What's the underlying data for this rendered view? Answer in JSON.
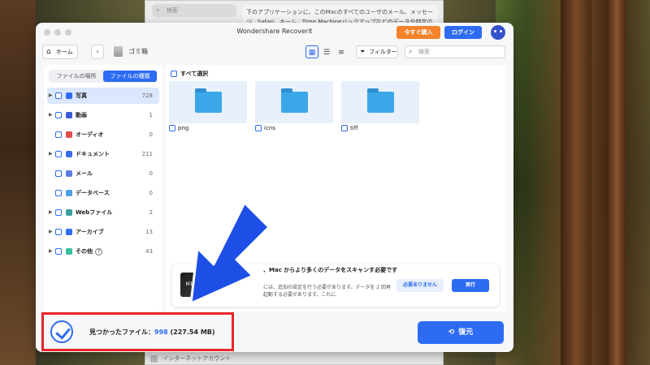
{
  "background_window": {
    "search_placeholder": "検索",
    "description": "下のアプリケーションに、このMacのすべてのユーザのメール、メッセージ、Safari、ホーム、Time Machineバックアップなどのデータや特定の管理設定へ",
    "bottom_item": "インターネットアカウント"
  },
  "app": {
    "title": "Wondershare Recoverit",
    "buy_label": "今すぐ購入",
    "login_label": "ログイン"
  },
  "toolbar": {
    "home_label": "ホーム",
    "crumb": "ゴミ箱",
    "filter_label": "フィルター",
    "search_placeholder": "検索"
  },
  "sidebar": {
    "tabs": [
      "ファイルの場所",
      "ファイルの種類"
    ],
    "active_tab": 1,
    "categories": [
      {
        "label": "写真",
        "count": "728",
        "icon_color": "#2d6cf2",
        "expand": true,
        "active": true
      },
      {
        "label": "動画",
        "count": "1",
        "icon_color": "#3b5bd6",
        "expand": true
      },
      {
        "label": "オーディオ",
        "count": "0",
        "icon_color": "#e34a4a",
        "expand": false
      },
      {
        "label": "ドキュメント",
        "count": "211",
        "icon_color": "#3a6ee8",
        "expand": true
      },
      {
        "label": "メール",
        "count": "0",
        "icon_color": "#5b7ee0",
        "expand": false
      },
      {
        "label": "データベース",
        "count": "0",
        "icon_color": "#4aa0e0",
        "expand": false
      },
      {
        "label": "Webファイル",
        "count": "2",
        "icon_color": "#3aa0a0",
        "expand": true
      },
      {
        "label": "アーカイブ",
        "count": "13",
        "icon_color": "#2d6cf2",
        "expand": true
      },
      {
        "label": "その他",
        "count": "43",
        "icon_color": "#35c0a0",
        "expand": true
      }
    ]
  },
  "main": {
    "select_all": "すべて選択",
    "folders": [
      "png",
      "icns",
      "tiff"
    ]
  },
  "notice": {
    "chip_label": "M1",
    "title": "、Mac からより多くのデータをスキャンす必要です",
    "desc": "には、追加の設定を行う必要があります。データを 2 回再起動する必要があります。これに",
    "no_thanks": "必要ありません",
    "execute": "実行"
  },
  "footer": {
    "found_label": "見つかったファイル：",
    "found_count": "998",
    "found_size": "(227.54 MB)",
    "recover_label": "復元"
  },
  "colors": {
    "accent": "#2d6cf2",
    "buy": "#f5822a",
    "highlight": "#e8262b",
    "arrow": "#1d4fe6"
  }
}
